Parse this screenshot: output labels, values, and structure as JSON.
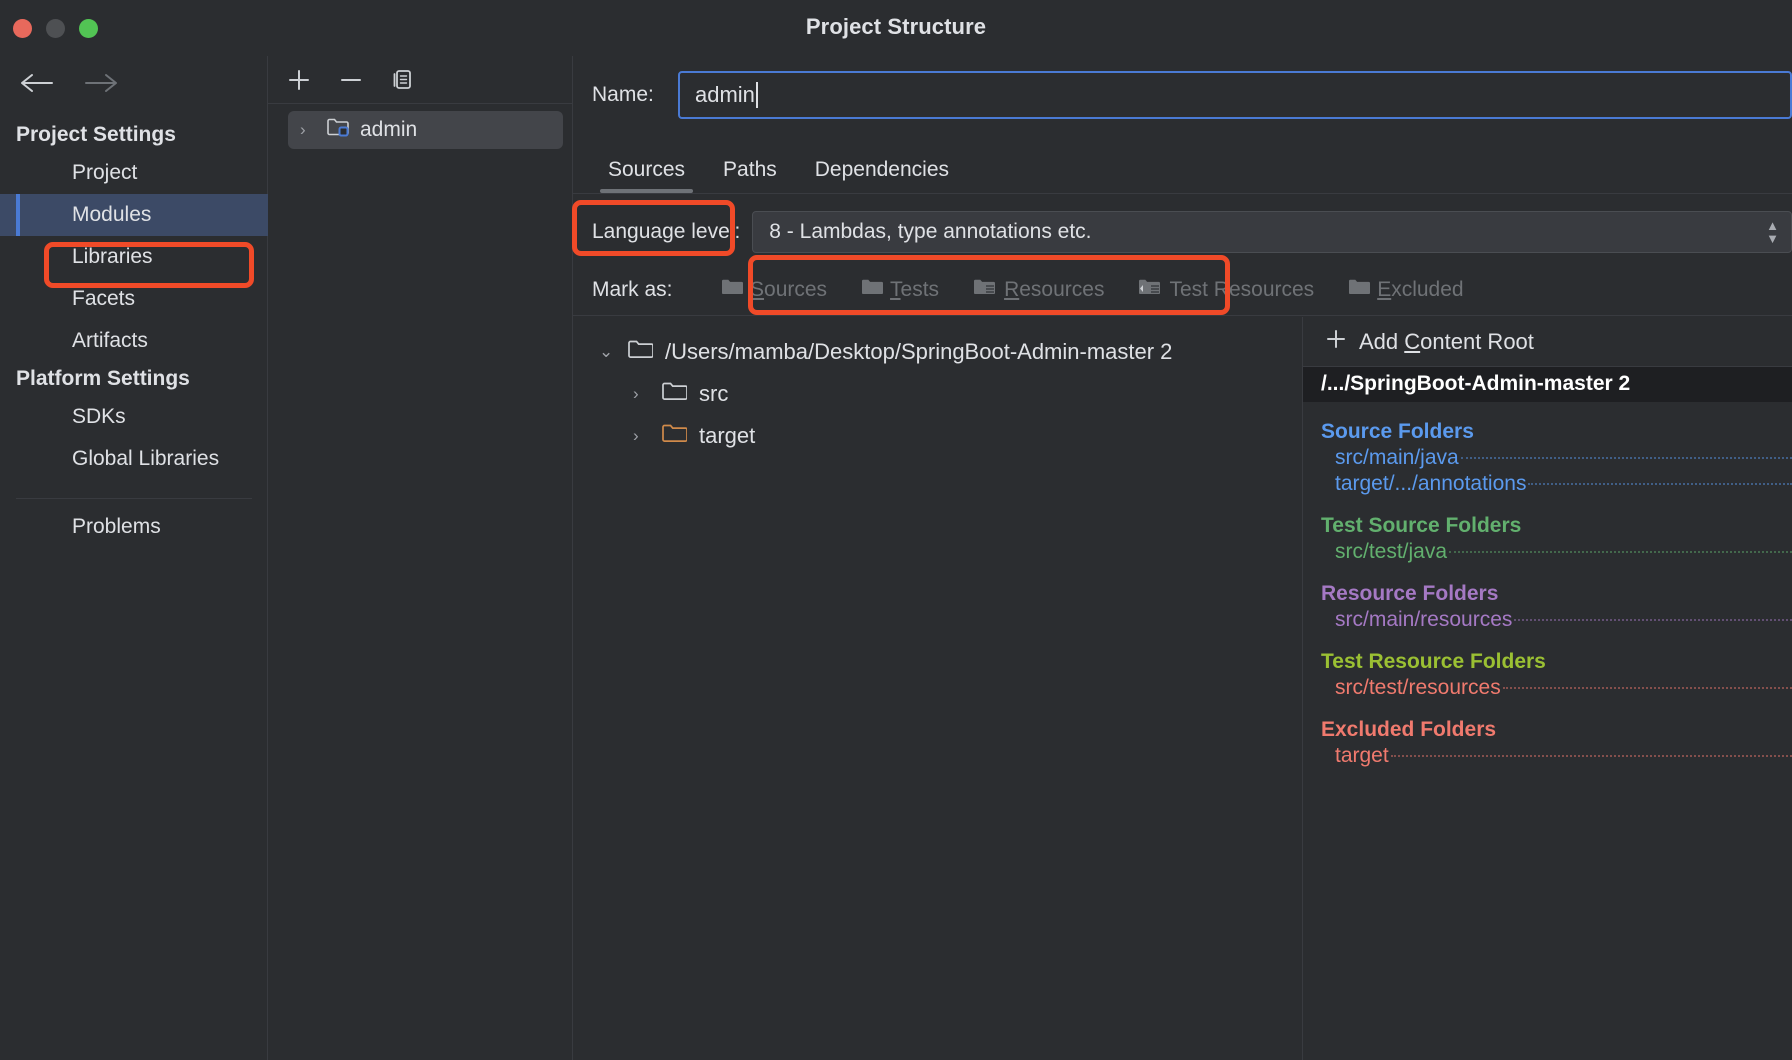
{
  "window": {
    "title": "Project Structure",
    "traffic": [
      "close-red",
      "minimize-yellow",
      "zoom-green"
    ]
  },
  "sidebar": {
    "back_label": "←",
    "forward_label": "→",
    "groups": [
      {
        "label": "Project Settings",
        "items": [
          {
            "label": "Project",
            "selected": false
          },
          {
            "label": "Modules",
            "selected": true
          },
          {
            "label": "Libraries",
            "selected": false
          },
          {
            "label": "Facets",
            "selected": false
          },
          {
            "label": "Artifacts",
            "selected": false
          }
        ]
      },
      {
        "label": "Platform Settings",
        "items": [
          {
            "label": "SDKs",
            "selected": false
          },
          {
            "label": "Global Libraries",
            "selected": false
          }
        ]
      }
    ],
    "problems_label": "Problems"
  },
  "modules_panel": {
    "toolbar": [
      {
        "name": "add-module-button",
        "glyph": "+"
      },
      {
        "name": "remove-module-button",
        "glyph": "−"
      },
      {
        "name": "copy-module-button",
        "glyph": "copy"
      }
    ],
    "tree": [
      {
        "label": "admin",
        "expanded": false,
        "selected": true
      }
    ]
  },
  "module_editor": {
    "name_label": "Name:",
    "name_value": "admin",
    "name_placeholder": "",
    "tabs": [
      {
        "label": "Sources",
        "active": true
      },
      {
        "label": "Paths",
        "active": false
      },
      {
        "label": "Dependencies",
        "active": false
      }
    ],
    "language_level_label": "Language level:",
    "language_level_value": "8 - Lambdas, type annotations etc.",
    "mark_as_label": "Mark as:",
    "mark_as_buttons": [
      {
        "label": "Sources",
        "mnemonic": "S",
        "icon": "folder-sources-icon"
      },
      {
        "label": "Tests",
        "mnemonic": "T",
        "icon": "folder-tests-icon"
      },
      {
        "label": "Resources",
        "mnemonic": "R",
        "icon": "folder-resources-icon"
      },
      {
        "label": "Test Resources",
        "mnemonic": "",
        "icon": "folder-test-resources-icon"
      },
      {
        "label": "Excluded",
        "mnemonic": "E",
        "icon": "folder-excluded-icon"
      }
    ],
    "content_tree": [
      {
        "label": "/Users/mamba/Desktop/SpringBoot-Admin-master 2",
        "level": 0,
        "expanded": true,
        "icon": "folder-icon"
      },
      {
        "label": "src",
        "level": 1,
        "expanded": false,
        "icon": "folder-icon"
      },
      {
        "label": "target",
        "level": 1,
        "expanded": false,
        "icon": "folder-excluded-orange-icon"
      }
    ],
    "roots_panel": {
      "add_content_root_label": "Add Content Root",
      "add_content_root_mnemonic": "C",
      "selected_root": "/.../SpringBoot-Admin-master 2",
      "groups": [
        {
          "title": "Source Folders",
          "color": "#5b9aee",
          "items": [
            {
              "label": "src/main/java",
              "color": "#5b9aee"
            },
            {
              "label": "target/.../annotations",
              "color": "#5b9aee"
            }
          ]
        },
        {
          "title": "Test Source Folders",
          "color": "#62b06e",
          "items": [
            {
              "label": "src/test/java",
              "color": "#62b06e"
            }
          ]
        },
        {
          "title": "Resource Folders",
          "color": "#a579c4",
          "items": [
            {
              "label": "src/main/resources",
              "color": "#a579c4"
            }
          ]
        },
        {
          "title": "Test Resource Folders",
          "color": "#9bc033",
          "items": [
            {
              "label": "src/test/resources",
              "color": "#f07a6e"
            }
          ]
        },
        {
          "title": "Excluded Folders",
          "color": "#f07a6e",
          "items": [
            {
              "label": "target",
              "color": "#f07a6e"
            }
          ]
        }
      ]
    }
  },
  "annotations": {
    "highlight_color": "#f04a28",
    "boxes": [
      "modules-sidebar-item",
      "sources-tab",
      "language-level-field"
    ]
  }
}
